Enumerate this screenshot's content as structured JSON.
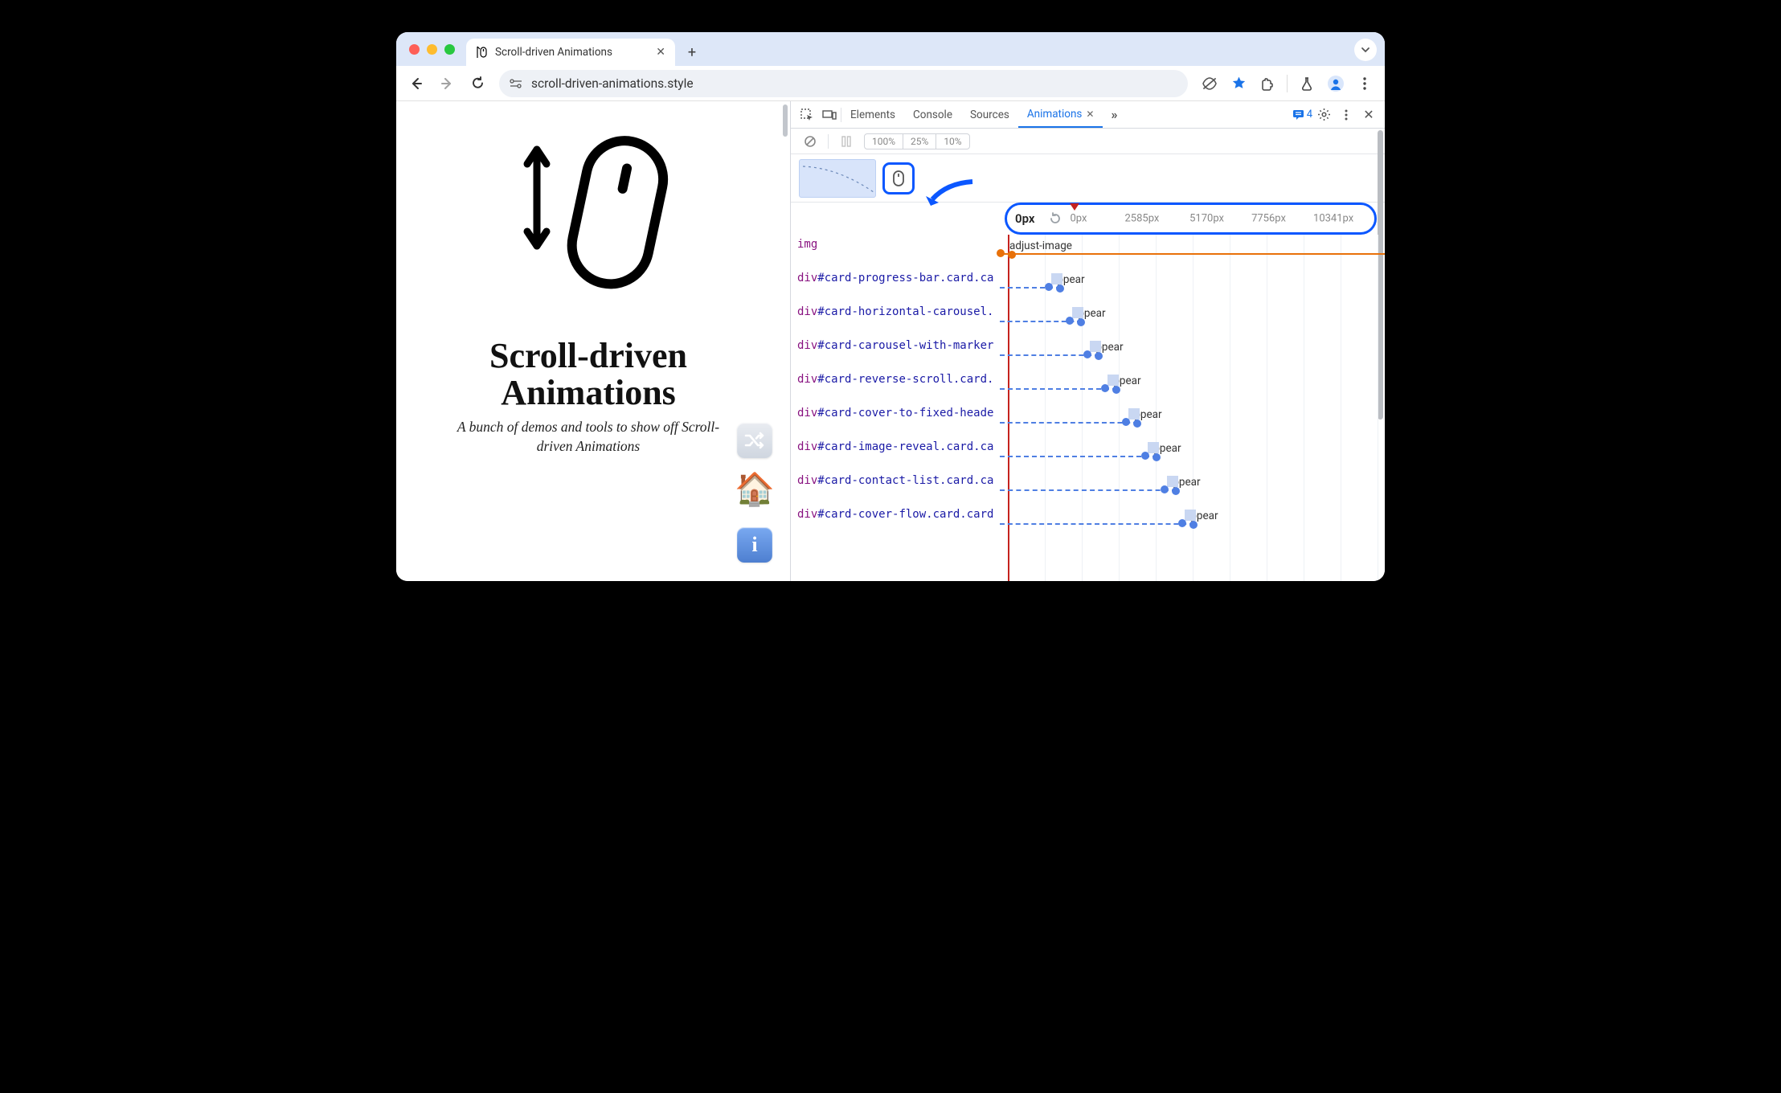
{
  "browser": {
    "tab": {
      "title": "Scroll-driven Animations"
    },
    "url": "scroll-driven-animations.style"
  },
  "page": {
    "heading_line1": "Scroll-driven",
    "heading_line2": "Animations",
    "subtitle": "A bunch of demos and tools to show off Scroll-driven Animations"
  },
  "devtools": {
    "tabs": {
      "elements": "Elements",
      "console": "Console",
      "sources": "Sources",
      "animations": "Animations"
    },
    "message_count": "4",
    "speeds": {
      "s100": "100%",
      "s25": "25%",
      "s10": "10%"
    },
    "timeline": {
      "current": "0px",
      "ticks": [
        "0px",
        "2585px",
        "5170px",
        "7756px",
        "10341px"
      ]
    },
    "rows": [
      {
        "tag": "img",
        "rest": "",
        "anim": "adjust-image",
        "offset": 0,
        "img": true
      },
      {
        "tag": "div",
        "rest": "#card-progress-bar.card.ca",
        "anim": "appear",
        "offset": 52
      },
      {
        "tag": "div",
        "rest": "#card-horizontal-carousel.",
        "anim": "appear",
        "offset": 78
      },
      {
        "tag": "div",
        "rest": "#card-carousel-with-marker",
        "anim": "appear",
        "offset": 100
      },
      {
        "tag": "div",
        "rest": "#card-reverse-scroll.card.",
        "anim": "appear",
        "offset": 122
      },
      {
        "tag": "div",
        "rest": "#card-cover-to-fixed-heade",
        "anim": "appear",
        "offset": 148
      },
      {
        "tag": "div",
        "rest": "#card-image-reveal.card.ca",
        "anim": "appear",
        "offset": 172
      },
      {
        "tag": "div",
        "rest": "#card-contact-list.card.ca",
        "anim": "appear",
        "offset": 196
      },
      {
        "tag": "div",
        "rest": "#card-cover-flow.card.card",
        "anim": "appear",
        "offset": 218
      }
    ]
  }
}
